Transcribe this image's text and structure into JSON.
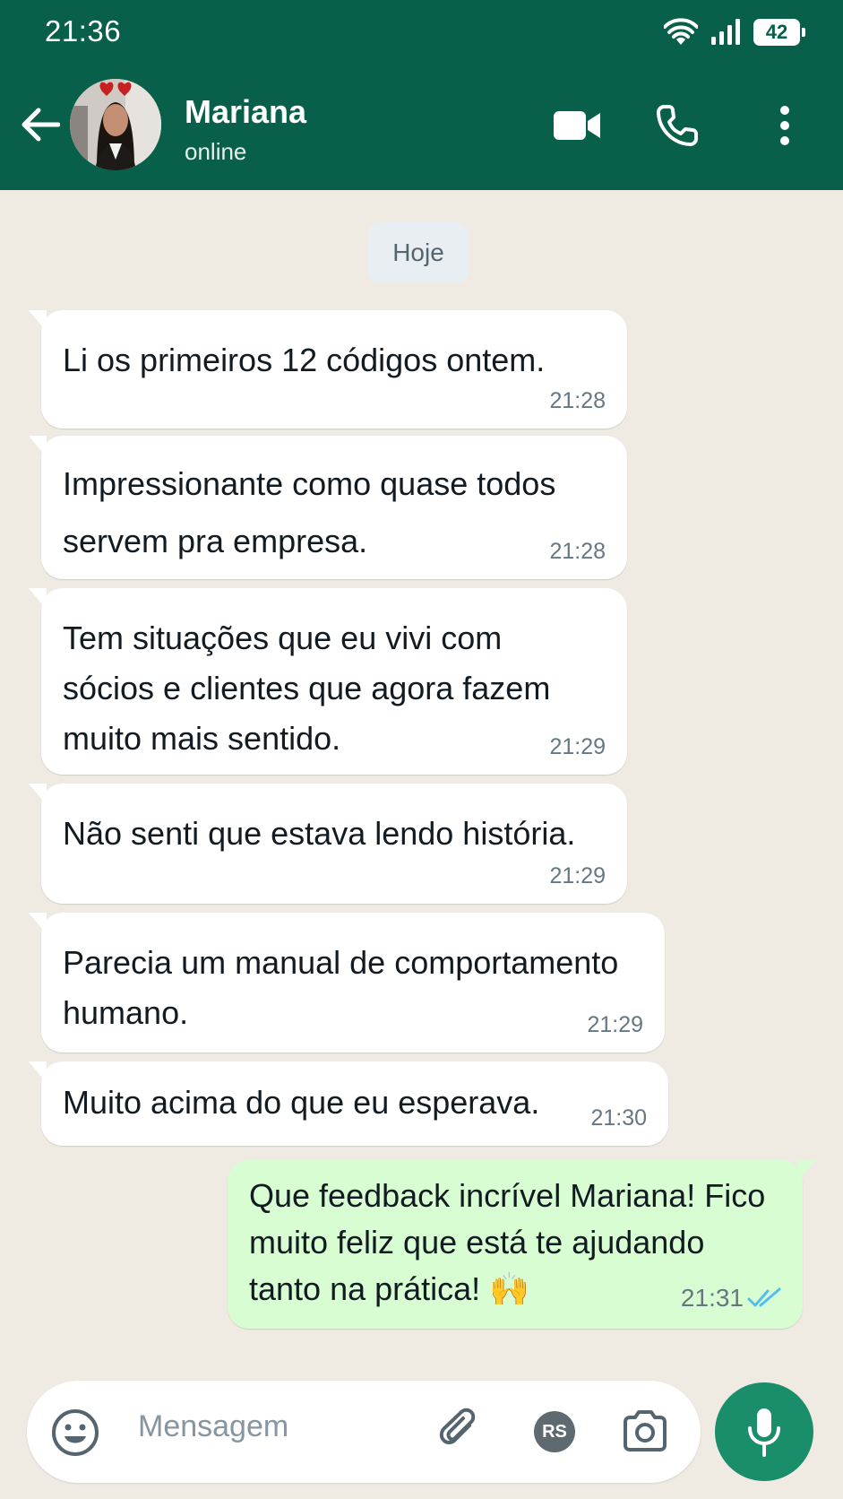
{
  "status_bar": {
    "time": "21:36",
    "battery": "42"
  },
  "header": {
    "contact_name": "Mariana",
    "contact_status": "online"
  },
  "chat": {
    "date_chip": "Hoje",
    "messages": [
      {
        "text": "Li os primeiros 12 códigos ontem.",
        "time": "21:28"
      },
      {
        "text": "Impressionante como quase todos servem pra empresa.",
        "time": "21:28"
      },
      {
        "text": "Tem situações que eu vivi com sócios e clientes que agora fazem muito mais sentido.",
        "time": "21:29"
      },
      {
        "text": "Não senti que estava lendo história.",
        "time": "21:29"
      },
      {
        "text": "Parecia um manual de comportamento humano.",
        "time": "21:29"
      },
      {
        "text": "Muito acima do que eu esperava.",
        "time": "21:30"
      },
      {
        "text": "Que feedback incrível Mariana! Fico muito feliz que está te ajudando tanto na prática! 🙌",
        "time": "21:31"
      }
    ]
  },
  "composer": {
    "placeholder": "Mensagem",
    "avatar_initials": "RS"
  },
  "colors": {
    "header": "#08604a",
    "outgoing_bubble": "#d9fdd3",
    "incoming_bubble": "#ffffff",
    "mic_button": "#1a8d6b",
    "read_ticks": "#53bdeb"
  }
}
